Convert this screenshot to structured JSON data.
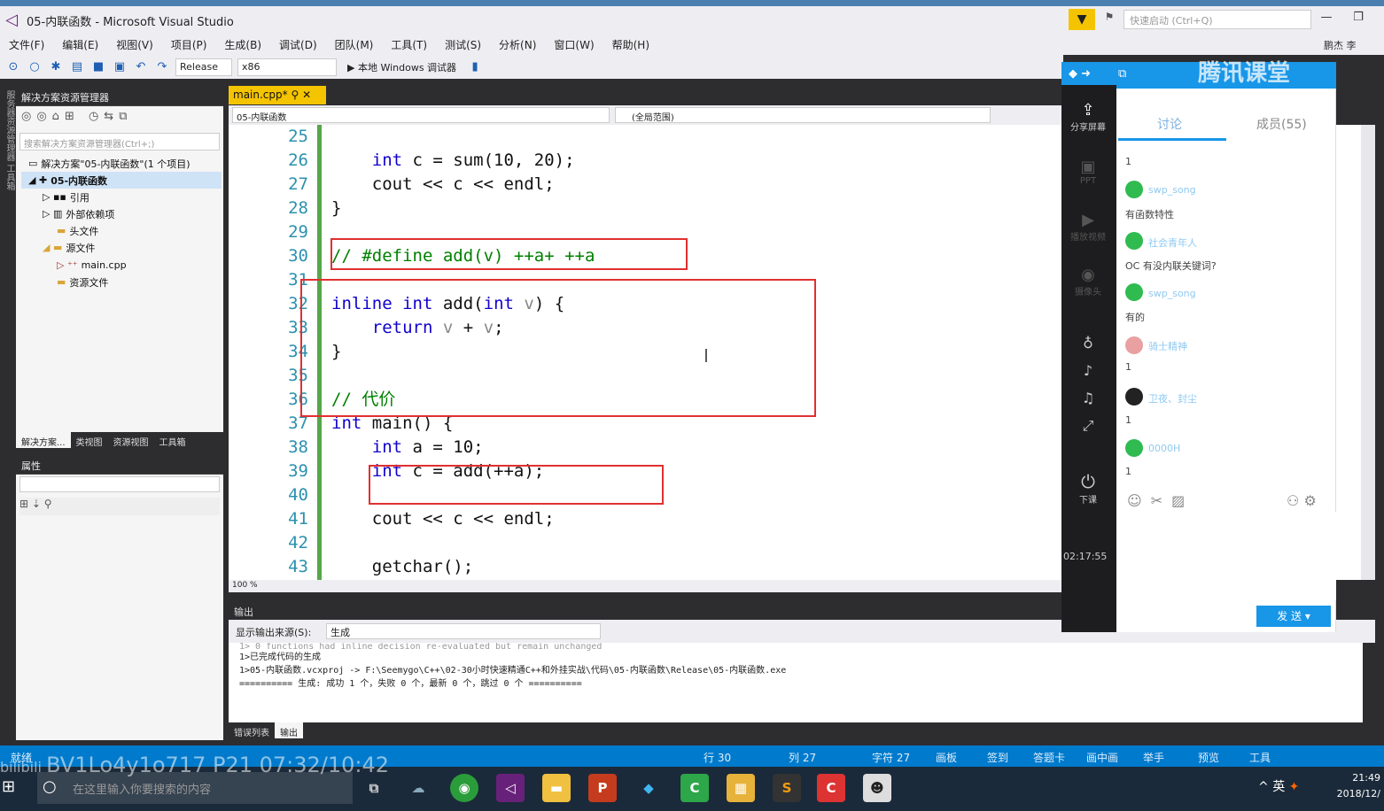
{
  "window": {
    "title": "05-内联函数 - Microsoft Visual Studio",
    "quick_launch": "快速启动 (Ctrl+Q)",
    "user": "鹏杰 李"
  },
  "menu": [
    "文件(F)",
    "编辑(E)",
    "视图(V)",
    "项目(P)",
    "生成(B)",
    "调试(D)",
    "团队(M)",
    "工具(T)",
    "测试(S)",
    "分析(N)",
    "窗口(W)",
    "帮助(H)"
  ],
  "toolbar": {
    "config": "Release",
    "platform": "x86",
    "run": "▶ 本地 Windows 调试器"
  },
  "solution_explorer": {
    "title": "解决方案资源管理器",
    "search": "搜索解决方案资源管理器(Ctrl+;)",
    "items": [
      {
        "label": "解决方案\"05-内联函数\"(1 个项目)",
        "indent": 0
      },
      {
        "label": "05-内联函数",
        "indent": 1
      },
      {
        "label": "引用",
        "indent": 2
      },
      {
        "label": "外部依赖项",
        "indent": 2
      },
      {
        "label": "头文件",
        "indent": 2
      },
      {
        "label": "源文件",
        "indent": 2
      },
      {
        "label": "main.cpp",
        "indent": 3
      },
      {
        "label": "资源文件",
        "indent": 2
      }
    ],
    "tabs": [
      "解决方案...",
      "类视图",
      "资源视图",
      "工具箱"
    ]
  },
  "properties": {
    "title": "属性"
  },
  "editor": {
    "tab": "main.cpp*",
    "nav_left": "05-内联函数",
    "nav_right": "(全局范围)",
    "zoom": "100 %",
    "lines": [
      {
        "n": "25",
        "html": ""
      },
      {
        "n": "26",
        "html": "    <span class='kw'>int</span> c = sum(10, 20);"
      },
      {
        "n": "27",
        "html": "    cout &lt;&lt; c &lt;&lt; endl;"
      },
      {
        "n": "28",
        "html": "}"
      },
      {
        "n": "29",
        "html": ""
      },
      {
        "n": "30",
        "html": "<span class='cm'>// #define add(v) ++a+ ++a</span>"
      },
      {
        "n": "31",
        "html": ""
      },
      {
        "n": "32",
        "html": "<span class='kw'>inline</span> <span class='kw'>int</span> add(<span class='kw'>int</span> <span class='pm'>v</span>) {"
      },
      {
        "n": "33",
        "html": "    <span class='kw'>return</span> <span class='pm'>v</span> + <span class='pm'>v</span>;"
      },
      {
        "n": "34",
        "html": "}"
      },
      {
        "n": "35",
        "html": ""
      },
      {
        "n": "36",
        "html": "<span class='cm'>// 代价</span>"
      },
      {
        "n": "37",
        "html": "<span class='kw'>int</span> main() {"
      },
      {
        "n": "38",
        "html": "    <span class='kw'>int</span> a = 10;"
      },
      {
        "n": "39",
        "html": "    <span class='kw'>int</span> c = add(++a);"
      },
      {
        "n": "40",
        "html": ""
      },
      {
        "n": "41",
        "html": "    cout &lt;&lt; c &lt;&lt; endl;"
      },
      {
        "n": "42",
        "html": ""
      },
      {
        "n": "43",
        "html": "    getchar();"
      }
    ]
  },
  "output": {
    "title": "输出",
    "source_label": "显示输出来源(S):",
    "source": "生成",
    "lines": [
      "1>  0 functions had inline decision re-evaluated but remain unchanged",
      "1>已完成代码的生成",
      "1>05-内联函数.vcxproj -> F:\\Seemygo\\C++\\02-30小时快速精通C++和外挂实战\\代码\\05-内联函数\\Release\\05-内联函数.exe",
      "========== 生成: 成功 1 个，失败 0 个，最新 0 个，跳过 0 个 =========="
    ],
    "tabs": [
      "错误列表",
      "输出"
    ]
  },
  "status": {
    "left": "就绪",
    "row": "行 30",
    "col": "列 27",
    "char": "字符 27",
    "extra": [
      "画板",
      "签到",
      "答题卡",
      "画中画",
      "举手",
      "预览",
      "工具"
    ]
  },
  "watermark": "BV1Lo4y1o717 P21 07:32/10:42",
  "taskbar": {
    "search": "在这里输入你要搜索的内容",
    "time": "21:49",
    "date": "2018/12/",
    "ime": "英"
  },
  "tencent": {
    "brand": "腾讯课堂",
    "tabs": [
      "讨论",
      "成员(55)"
    ],
    "side": [
      "分享屏幕",
      "PPT",
      "播放视频",
      "摄像头",
      "下课"
    ],
    "time": "02:17:55",
    "messages": [
      {
        "name": "",
        "text": "1"
      },
      {
        "name": "swp_song",
        "text": "有函数特性"
      },
      {
        "name": "社会青年人",
        "text": "OC 有没内联关键词?"
      },
      {
        "name": "swp_song",
        "text": "有的"
      },
      {
        "name": "骑士精神",
        "text": "1"
      },
      {
        "name": "卫夜、封尘",
        "text": "1"
      },
      {
        "name": "0000H",
        "text": "1"
      }
    ],
    "send": "发 送"
  }
}
